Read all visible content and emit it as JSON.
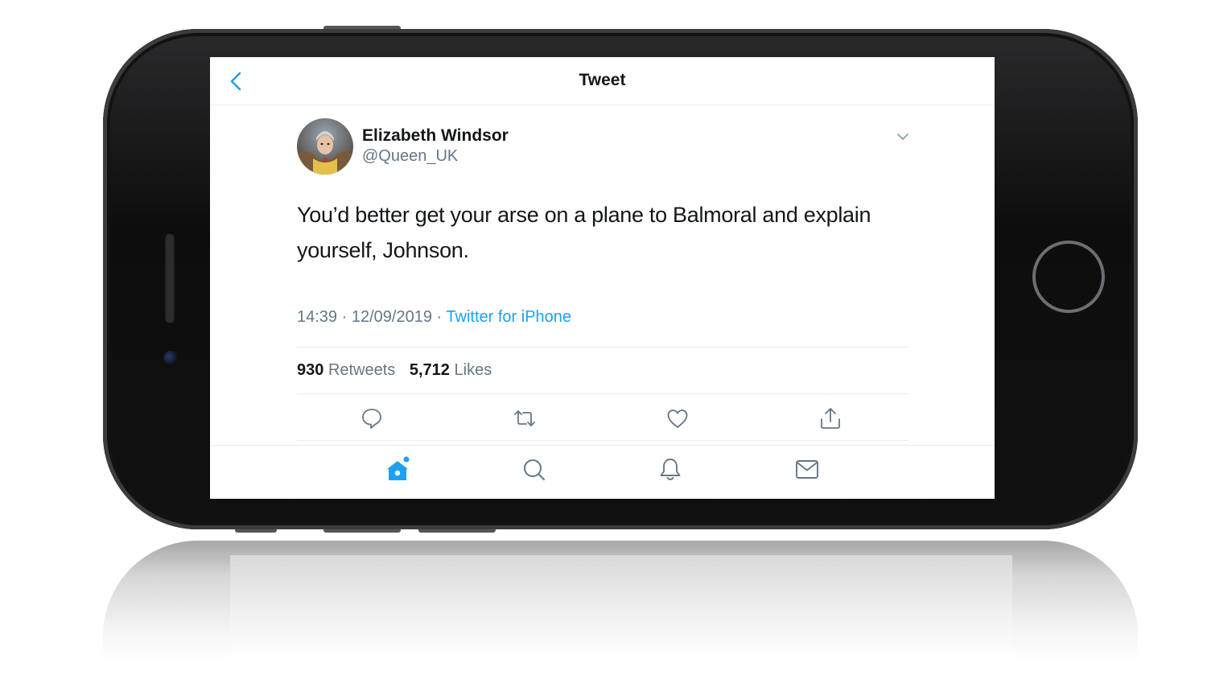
{
  "navbar": {
    "back_icon": "chevron-left-icon",
    "title": "Tweet"
  },
  "tweet": {
    "author_name": "Elizabeth Windsor",
    "author_handle": "@Queen_UK",
    "text": "You’d better get your arse on a plane to Balmoral and explain yourself, Johnson.",
    "time": "14:39",
    "date": "12/09/2019",
    "separator": "·",
    "source": "Twitter for iPhone",
    "retweets_count": "930",
    "retweets_label": "Retweets",
    "likes_count": "5,712",
    "likes_label": "Likes"
  },
  "actions": [
    "reply-icon",
    "retweet-icon",
    "like-icon",
    "share-icon"
  ],
  "tabbar": {
    "tabs": [
      "home-icon",
      "search-icon",
      "notifications-icon",
      "messages-icon"
    ],
    "active_tab": "home-icon"
  },
  "colors": {
    "accent": "#1da1f2",
    "text_primary": "#14171a",
    "text_secondary": "#657786",
    "divider": "#e6ecf0"
  }
}
